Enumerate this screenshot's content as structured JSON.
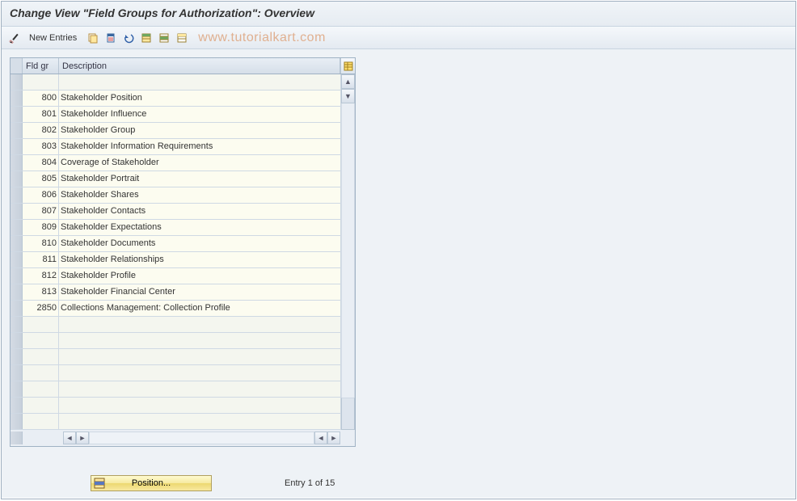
{
  "title": "Change View \"Field Groups for Authorization\": Overview",
  "toolbar": {
    "new_entries": "New Entries"
  },
  "watermark": "www.tutorialkart.com",
  "table": {
    "headers": {
      "fld": "Fld gr",
      "desc": "Description"
    },
    "rows": [
      {
        "fld": "",
        "desc": ""
      },
      {
        "fld": "800",
        "desc": "Stakeholder Position"
      },
      {
        "fld": "801",
        "desc": "Stakeholder Influence"
      },
      {
        "fld": "802",
        "desc": "Stakeholder Group"
      },
      {
        "fld": "803",
        "desc": "Stakeholder Information Requirements"
      },
      {
        "fld": "804",
        "desc": "Coverage of Stakeholder"
      },
      {
        "fld": "805",
        "desc": "Stakeholder Portrait"
      },
      {
        "fld": "806",
        "desc": "Stakeholder Shares"
      },
      {
        "fld": "807",
        "desc": "Stakeholder Contacts"
      },
      {
        "fld": "809",
        "desc": "Stakeholder Expectations"
      },
      {
        "fld": "810",
        "desc": "Stakeholder Documents"
      },
      {
        "fld": "811",
        "desc": "Stakeholder Relationships"
      },
      {
        "fld": "812",
        "desc": "Stakeholder Profile"
      },
      {
        "fld": "813",
        "desc": "Stakeholder Financial Center"
      },
      {
        "fld": "2850",
        "desc": "Collections Management: Collection Profile"
      },
      {
        "fld": "",
        "desc": ""
      },
      {
        "fld": "",
        "desc": ""
      },
      {
        "fld": "",
        "desc": ""
      },
      {
        "fld": "",
        "desc": ""
      },
      {
        "fld": "",
        "desc": ""
      },
      {
        "fld": "",
        "desc": ""
      },
      {
        "fld": "",
        "desc": ""
      }
    ]
  },
  "footer": {
    "position_label": "Position...",
    "entry_label": "Entry 1 of 15"
  }
}
